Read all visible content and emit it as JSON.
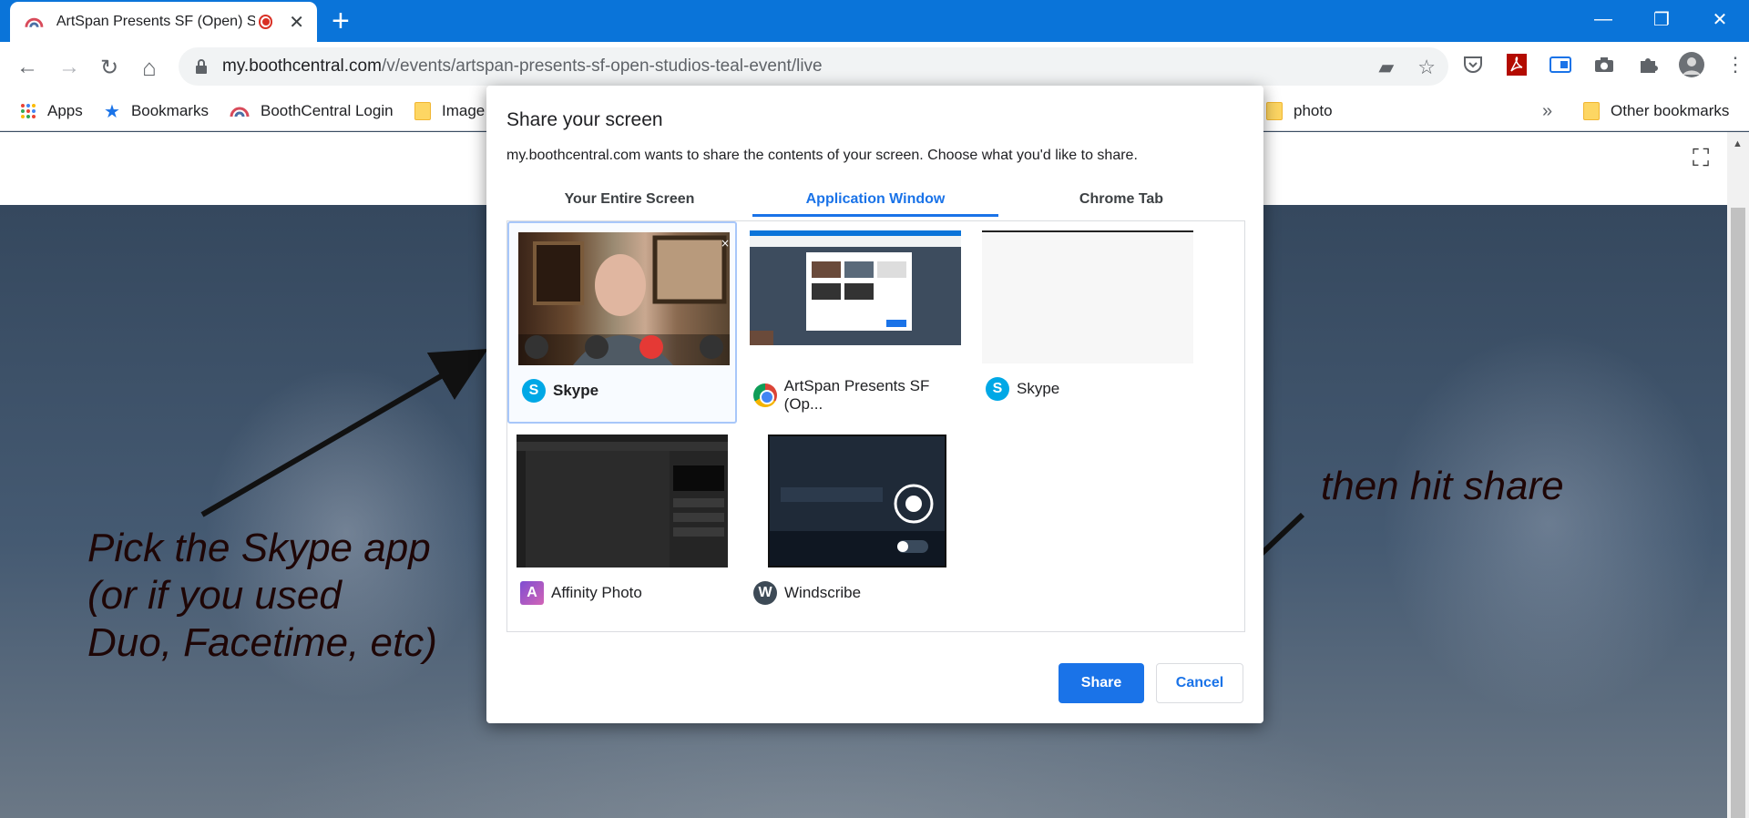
{
  "browser": {
    "tab_title": "ArtSpan Presents SF (Open) S",
    "tab_close": "✕",
    "new_tab": "+",
    "window_controls": {
      "minimize": "—",
      "restore": "❐",
      "close": "✕"
    },
    "nav": {
      "back": "←",
      "forward": "→",
      "reload": "↻",
      "home": "⌂"
    },
    "url_host": "my.boothcentral.com",
    "url_path": "/v/events/artspan-presents-sf-open-studios-teal-event/live",
    "omnibox_icons": {
      "camera": "▰",
      "star": "☆"
    },
    "extensions": {
      "menu": "⋮"
    }
  },
  "bookmarks": {
    "items": [
      {
        "label": "Apps"
      },
      {
        "label": "Bookmarks"
      },
      {
        "label": "BoothCentral Login"
      },
      {
        "label": "Image"
      },
      {
        "label": "photo"
      }
    ],
    "overflow": "»",
    "other": "Other bookmarks"
  },
  "page": {
    "fullscreen_icon": "⛶",
    "scroll_up": "▲"
  },
  "annotations": {
    "left_line1": "Pick the Skype app",
    "left_line2": "(or if you used",
    "left_line3": "Duo, Facetime, etc)",
    "right": "then hit share"
  },
  "dialog": {
    "title": "Share your screen",
    "description": "my.boothcentral.com wants to share the contents of your screen. Choose what you'd like to share.",
    "tabs": [
      "Your Entire Screen",
      "Application Window",
      "Chrome Tab"
    ],
    "active_tab": "Application Window",
    "items": [
      {
        "label": "Skype",
        "icon": "skype-icon",
        "selected": true
      },
      {
        "label": "ArtSpan Presents SF (Op...",
        "icon": "chrome-icon",
        "selected": false
      },
      {
        "label": "Skype",
        "icon": "skype-icon",
        "selected": false
      },
      {
        "label": "Affinity Photo",
        "icon": "affinity-photo-icon",
        "selected": false
      },
      {
        "label": "Windscribe",
        "icon": "windscribe-icon",
        "selected": false
      }
    ],
    "share_label": "Share",
    "cancel_label": "Cancel"
  },
  "colors": {
    "chrome_blue": "#0a74d9",
    "accent": "#1a73e8",
    "skype": "#00a8e6",
    "annotation_text": "#1e0606"
  }
}
